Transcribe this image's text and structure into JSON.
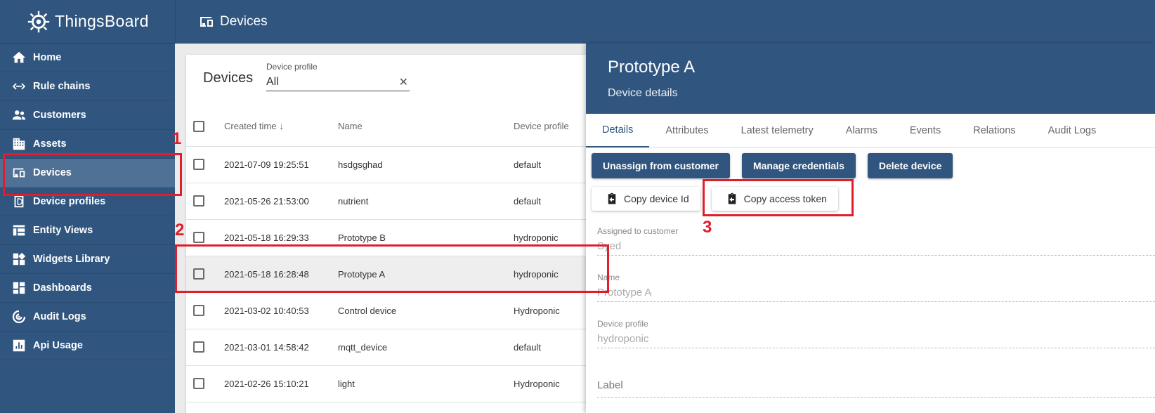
{
  "app": {
    "name": "ThingsBoard"
  },
  "sidebar": {
    "items": [
      {
        "label": "Home",
        "icon": "home-icon"
      },
      {
        "label": "Rule chains",
        "icon": "rule-chains-icon"
      },
      {
        "label": "Customers",
        "icon": "customers-icon"
      },
      {
        "label": "Assets",
        "icon": "assets-icon"
      },
      {
        "label": "Devices",
        "icon": "devices-icon",
        "active": true
      },
      {
        "label": "Device profiles",
        "icon": "device-profiles-icon"
      },
      {
        "label": "Entity Views",
        "icon": "entity-views-icon"
      },
      {
        "label": "Widgets Library",
        "icon": "widgets-library-icon"
      },
      {
        "label": "Dashboards",
        "icon": "dashboards-icon"
      },
      {
        "label": "Audit Logs",
        "icon": "audit-logs-icon"
      },
      {
        "label": "Api Usage",
        "icon": "api-usage-icon"
      }
    ]
  },
  "topbar": {
    "title": "Devices"
  },
  "devices": {
    "title": "Devices",
    "filter": {
      "label": "Device profile",
      "value": "All",
      "clear": "✕"
    },
    "columns": {
      "created": "Created time",
      "name": "Name",
      "profile": "Device profile"
    },
    "rows": [
      {
        "created": "2021-07-09 19:25:51",
        "name": "hsdgsghad",
        "profile": "default"
      },
      {
        "created": "2021-05-26 21:53:00",
        "name": "nutrient",
        "profile": "default"
      },
      {
        "created": "2021-05-18 16:29:33",
        "name": "Prototype B",
        "profile": "hydroponic"
      },
      {
        "created": "2021-05-18 16:28:48",
        "name": "Prototype A",
        "profile": "hydroponic",
        "selected": true
      },
      {
        "created": "2021-03-02 10:40:53",
        "name": "Control device",
        "profile": "Hydroponic"
      },
      {
        "created": "2021-03-01 14:58:42",
        "name": "mqtt_device",
        "profile": "default"
      },
      {
        "created": "2021-02-26 15:10:21",
        "name": "light",
        "profile": "Hydroponic"
      }
    ]
  },
  "details": {
    "title": "Prototype A",
    "subtitle": "Device details",
    "tabs": [
      "Details",
      "Attributes",
      "Latest telemetry",
      "Alarms",
      "Events",
      "Relations",
      "Audit Logs"
    ],
    "buttons": {
      "unassign": "Unassign from customer",
      "manage_credentials": "Manage credentials",
      "delete": "Delete device",
      "copy_id": "Copy device Id",
      "copy_token": "Copy access token"
    },
    "fields": {
      "customer_label": "Assigned to customer",
      "customer_value": "Syed",
      "name_label": "Name",
      "name_value": "Prototype A",
      "profile_label": "Device profile",
      "profile_value": "hydroponic",
      "label_label": "Label"
    }
  },
  "annotations": {
    "step1": "1",
    "step2": "2",
    "step3": "3",
    "color": "#e01e2b"
  },
  "colors": {
    "primary": "#305680",
    "active_nav": "#4f7196"
  }
}
